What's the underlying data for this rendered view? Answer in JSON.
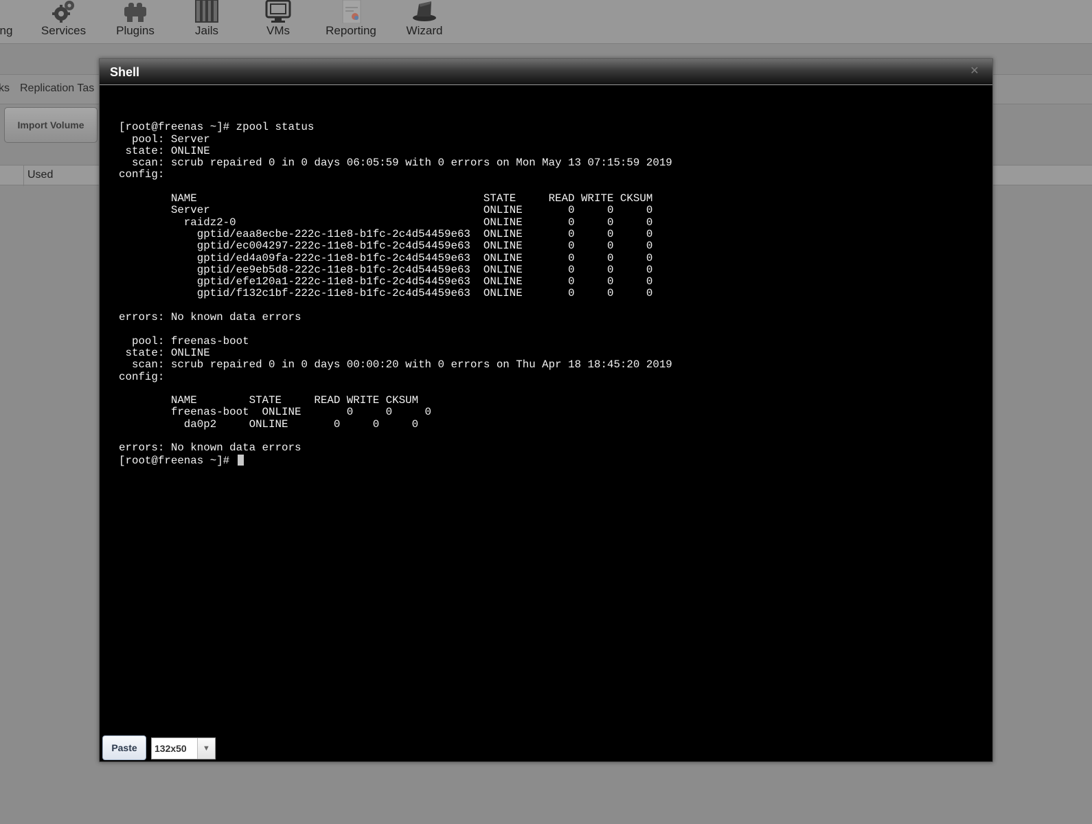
{
  "nav": {
    "items": [
      {
        "label": "ng",
        "icon": "gear-partial-icon"
      },
      {
        "label": "Services",
        "icon": "gears-icon"
      },
      {
        "label": "Plugins",
        "icon": "puzzle-icon"
      },
      {
        "label": "Jails",
        "icon": "jail-bars-icon"
      },
      {
        "label": "VMs",
        "icon": "monitor-icon"
      },
      {
        "label": "Reporting",
        "icon": "report-icon"
      },
      {
        "label": "Wizard",
        "icon": "wizard-hat-icon"
      }
    ]
  },
  "background": {
    "subtabs": [
      "ks",
      "Replication Tas"
    ],
    "import_button": "Import Volume",
    "table_header": {
      "col_used": "Used"
    }
  },
  "shell": {
    "title": "Shell",
    "close_icon": "close-icon",
    "lines": [
      "",
      "[root@freenas ~]# zpool status",
      "  pool: Server",
      " state: ONLINE",
      "  scan: scrub repaired 0 in 0 days 06:05:59 with 0 errors on Mon May 13 07:15:59 2019",
      "config:",
      "",
      "        NAME                                            STATE     READ WRITE CKSUM",
      "        Server                                          ONLINE       0     0     0",
      "          raidz2-0                                      ONLINE       0     0     0",
      "            gptid/eaa8ecbe-222c-11e8-b1fc-2c4d54459e63  ONLINE       0     0     0",
      "            gptid/ec004297-222c-11e8-b1fc-2c4d54459e63  ONLINE       0     0     0",
      "            gptid/ed4a09fa-222c-11e8-b1fc-2c4d54459e63  ONLINE       0     0     0",
      "            gptid/ee9eb5d8-222c-11e8-b1fc-2c4d54459e63  ONLINE       0     0     0",
      "            gptid/efe120a1-222c-11e8-b1fc-2c4d54459e63  ONLINE       0     0     0",
      "            gptid/f132c1bf-222c-11e8-b1fc-2c4d54459e63  ONLINE       0     0     0",
      "",
      "errors: No known data errors",
      "",
      "  pool: freenas-boot",
      " state: ONLINE",
      "  scan: scrub repaired 0 in 0 days 00:00:20 with 0 errors on Thu Apr 18 18:45:20 2019",
      "config:",
      "",
      "        NAME        STATE     READ WRITE CKSUM",
      "        freenas-boot  ONLINE       0     0     0",
      "          da0p2     ONLINE       0     0     0",
      "",
      "errors: No known data errors"
    ],
    "prompt": "[root@freenas ~]# ",
    "paste_button": "Paste",
    "terminal_size": "132x50"
  }
}
